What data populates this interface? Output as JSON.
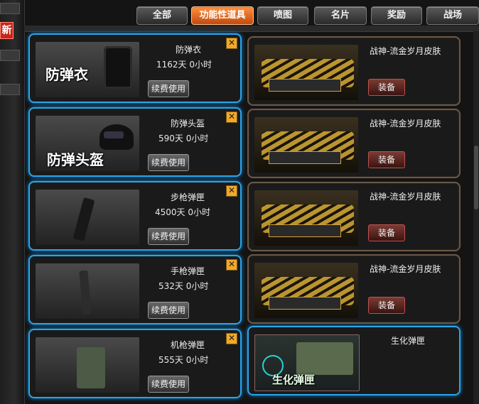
{
  "tabs": [
    {
      "label": "全部",
      "active": false
    },
    {
      "label": "功能性道具",
      "active": true
    },
    {
      "label": "喷图",
      "active": false
    },
    {
      "label": "名片",
      "active": false
    },
    {
      "label": "奖励",
      "active": false
    },
    {
      "label": "战场",
      "active": false
    }
  ],
  "side_badge": "新",
  "left_cards": [
    {
      "thumb_caption": "防弹衣",
      "name": "防弹衣",
      "duration": "1162天 0小时",
      "button": "续费使用",
      "close": "✕",
      "icon": "vest-icon"
    },
    {
      "thumb_caption": "防弹头盔",
      "name": "防弹头盔",
      "duration": "590天 0小时",
      "button": "续费使用",
      "close": "✕",
      "icon": "helmet-icon"
    },
    {
      "thumb_caption": "",
      "name": "步枪弹匣",
      "duration": "4500天 0小时",
      "button": "续费使用",
      "close": "✕",
      "icon": "rifle-magazine-icon"
    },
    {
      "thumb_caption": "",
      "name": "手枪弹匣",
      "duration": "532天 0小时",
      "button": "续费使用",
      "close": "✕",
      "icon": "pistol-magazine-icon"
    },
    {
      "thumb_caption": "",
      "name": "机枪弹匣",
      "duration": "555天 0小时",
      "button": "续费使用",
      "close": "✕",
      "icon": "mg-magazine-icon"
    }
  ],
  "right_cards": [
    {
      "name": "战神-流金岁月皮肤",
      "button": "装备",
      "icon": "gold-weapon-skin-icon"
    },
    {
      "name": "战神-流金岁月皮肤",
      "button": "装备",
      "icon": "gold-weapon-skin-icon"
    },
    {
      "name": "战神-流金岁月皮肤",
      "button": "装备",
      "icon": "gold-weapon-skin-icon"
    },
    {
      "name": "战神-流金岁月皮肤",
      "button": "装备",
      "icon": "gold-weapon-skin-icon"
    },
    {
      "name": "生化弹匣",
      "button": "",
      "thumb_caption": "生化弹匣",
      "icon": "bio-ammo-icon"
    }
  ],
  "colors": {
    "selected_border": "#2aa4e8",
    "normal_border": "#6a5848",
    "active_tab": "#e06a20",
    "close_button": "#f2a928"
  }
}
